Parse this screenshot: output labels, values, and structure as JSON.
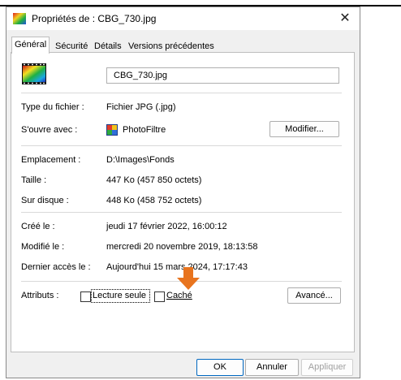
{
  "window": {
    "title": "Propriétés de : CBG_730.jpg",
    "close": "✕"
  },
  "tabs": [
    {
      "label": "Général"
    },
    {
      "label": "Sécurité"
    },
    {
      "label": "Détails"
    },
    {
      "label": "Versions précédentes"
    }
  ],
  "file": {
    "name": "CBG_730.jpg"
  },
  "info": {
    "type_label": "Type du fichier :",
    "type_value": "Fichier JPG (.jpg)",
    "opens_label": "S'ouvre avec :",
    "opens_value": "PhotoFiltre",
    "change_button": "Modifier...",
    "location_label": "Emplacement :",
    "location_value": "D:\\Images\\Fonds",
    "size_label": "Taille :",
    "size_value": "447 Ko (457 850 octets)",
    "disk_label": "Sur disque :",
    "disk_value": "448 Ko (458 752 octets)",
    "created_label": "Créé le :",
    "created_value": "jeudi 17 février 2022, 16:00:12",
    "modified_label": "Modifié le :",
    "modified_value": "mercredi 20 novembre 2019, 18:13:58",
    "accessed_label": "Dernier accès le :",
    "accessed_value": "Aujourd'hui 15 mars 2024, 17:17:43"
  },
  "attributes": {
    "label": "Attributs :",
    "readonly": "Lecture seule",
    "hidden": "Caché",
    "advanced_button": "Avancé..."
  },
  "footer": {
    "ok": "OK",
    "cancel": "Annuler",
    "apply": "Appliquer"
  },
  "colors": {
    "arrow": "#e8741e",
    "apply_disabled": "#a0a0a0"
  }
}
